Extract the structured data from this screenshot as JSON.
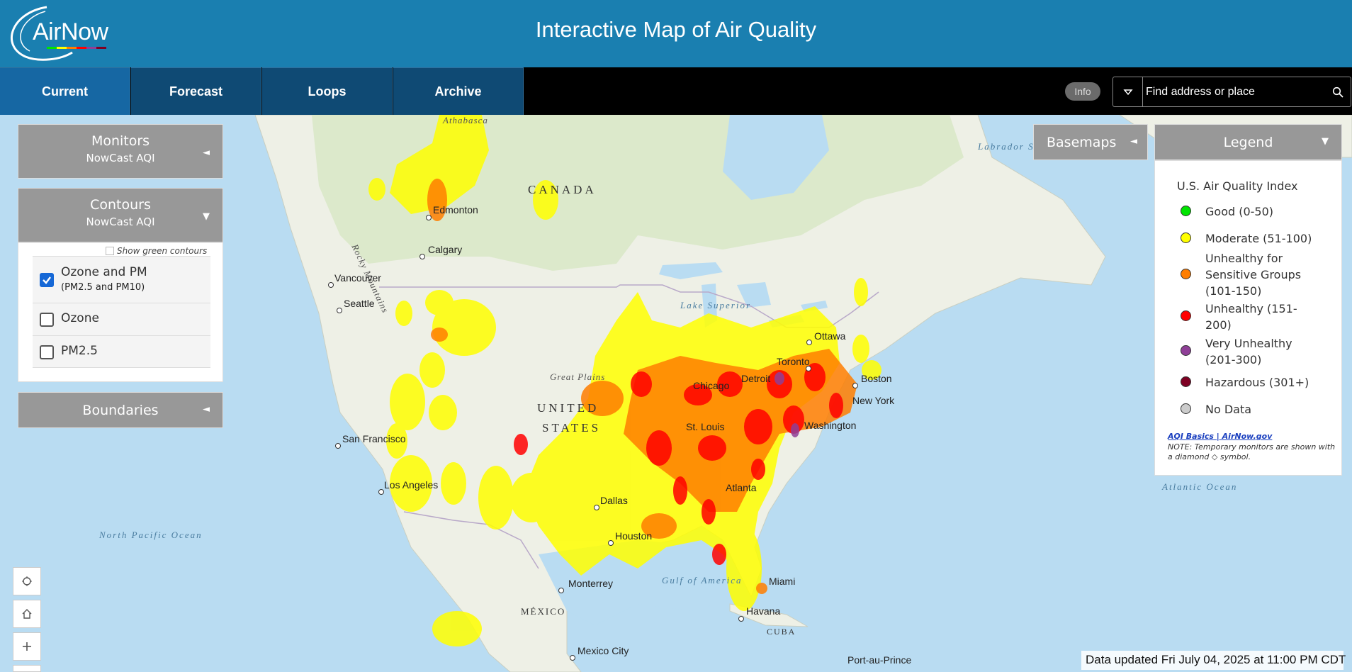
{
  "header": {
    "logo_text": "AirNow",
    "title": "Interactive Map of Air Quality"
  },
  "nav": {
    "tabs": [
      {
        "label": "Current",
        "active": true
      },
      {
        "label": "Forecast",
        "active": false
      },
      {
        "label": "Loops",
        "active": false
      },
      {
        "label": "Archive",
        "active": false
      }
    ],
    "info_label": "Info",
    "search_placeholder": "Find address or place"
  },
  "panels": {
    "monitors": {
      "title": "Monitors",
      "subtitle": "NowCast AQI",
      "arrow": "◄"
    },
    "contours": {
      "title": "Contours",
      "subtitle": "NowCast AQI",
      "arrow": "▼",
      "show_green": "Show green contours",
      "options": [
        {
          "label": "Ozone and PM",
          "sub": "(PM2.5 and PM10)",
          "checked": true
        },
        {
          "label": "Ozone",
          "sub": "",
          "checked": false
        },
        {
          "label": "PM2.5",
          "sub": "",
          "checked": false
        }
      ]
    },
    "boundaries": {
      "title": "Boundaries",
      "arrow": "◄"
    },
    "basemaps": {
      "title": "Basemaps",
      "arrow": "◄"
    },
    "legend": {
      "title": "Legend",
      "arrow": "▼",
      "heading": "U.S. Air Quality Index",
      "items": [
        {
          "label": "Good (0-50)",
          "color": "#00e400"
        },
        {
          "label": "Moderate (51-100)",
          "color": "#ffff00"
        },
        {
          "label": "Unhealthy for Sensitive Groups (101-150)",
          "color": "#ff7e00"
        },
        {
          "label": "Unhealthy (151-200)",
          "color": "#ff0000"
        },
        {
          "label": "Very Unhealthy (201-300)",
          "color": "#8f3f97"
        },
        {
          "label": "Hazardous (301+)",
          "color": "#7e0023"
        },
        {
          "label": "No Data",
          "color": "#cccccc"
        }
      ],
      "link": "AQI Basics | AirNow.gov",
      "note": "NOTE: Temporary monitors are shown with a diamond ◇ symbol."
    }
  },
  "map": {
    "countries": [
      "CANADA",
      "UNITED",
      "STATES",
      "MÉXICO",
      "CUBA"
    ],
    "cities": [
      "Edmonton",
      "Calgary",
      "Vancouver",
      "Seattle",
      "San Francisco",
      "Los Angeles",
      "Dallas",
      "Houston",
      "Monterrey",
      "Mexico City",
      "Chicago",
      "St. Louis",
      "Atlanta",
      "Detroit",
      "Toronto",
      "Ottawa",
      "Boston",
      "New York",
      "Washington",
      "Miami",
      "Havana",
      "Port-au-Prince"
    ],
    "regions": [
      "Athabasca",
      "Rocky Mountains",
      "Great Plains",
      "Lake Superior",
      "Gulf of America",
      "Labrador Sea",
      "North Pacific Ocean",
      "Atlantic Ocean"
    ]
  },
  "status": {
    "updated": "Data updated Fri July 04, 2025 at 11:00 PM CDT"
  }
}
